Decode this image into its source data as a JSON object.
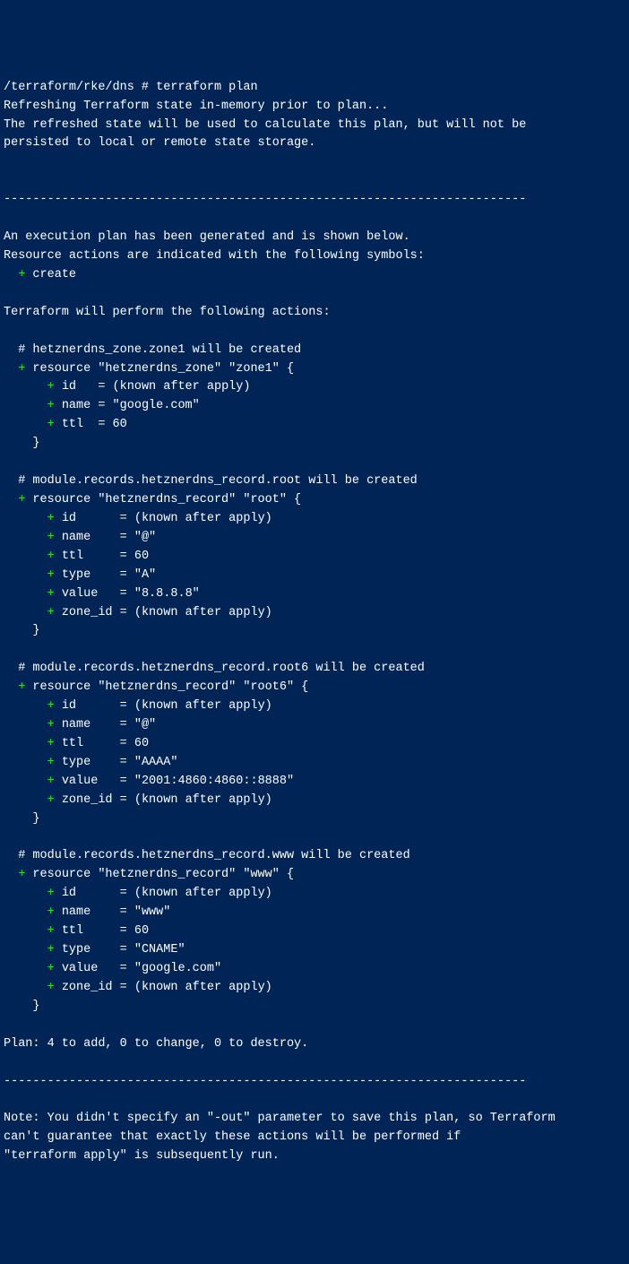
{
  "prompt": {
    "path": "/terraform/rke/dns #",
    "command": "terraform plan"
  },
  "header": {
    "l1": "Refreshing Terraform state in-memory prior to plan...",
    "l2": "The refreshed state will be used to calculate this plan, but will not be",
    "l3": "persisted to local or remote state storage.",
    "hr": "------------------------------------------------------------------------",
    "l4": "An execution plan has been generated and is shown below.",
    "l5": "Resource actions are indicated with the following symbols:",
    "create_sym": "+",
    "create_word": "create",
    "l6": "Terraform will perform the following actions:"
  },
  "resources": [
    {
      "comment": "# hetznerdns_zone.zone1 will be created",
      "decl_pre": " resource \"hetznerdns_zone\" \"zone1\" {",
      "attrs": [
        {
          "key": "id  ",
          "val": "(known after apply)"
        },
        {
          "key": "name",
          "val": "\"google.com\""
        },
        {
          "key": "ttl ",
          "val": "60"
        }
      ],
      "close": "    }"
    },
    {
      "comment": "# module.records.hetznerdns_record.root will be created",
      "decl_pre": " resource \"hetznerdns_record\" \"root\" {",
      "attrs": [
        {
          "key": "id     ",
          "val": "(known after apply)"
        },
        {
          "key": "name   ",
          "val": "\"@\""
        },
        {
          "key": "ttl    ",
          "val": "60"
        },
        {
          "key": "type   ",
          "val": "\"A\""
        },
        {
          "key": "value  ",
          "val": "\"8.8.8.8\""
        },
        {
          "key": "zone_id",
          "val": "(known after apply)"
        }
      ],
      "close": "    }"
    },
    {
      "comment": "# module.records.hetznerdns_record.root6 will be created",
      "decl_pre": " resource \"hetznerdns_record\" \"root6\" {",
      "attrs": [
        {
          "key": "id     ",
          "val": "(known after apply)"
        },
        {
          "key": "name   ",
          "val": "\"@\""
        },
        {
          "key": "ttl    ",
          "val": "60"
        },
        {
          "key": "type   ",
          "val": "\"AAAA\""
        },
        {
          "key": "value  ",
          "val": "\"2001:4860:4860::8888\""
        },
        {
          "key": "zone_id",
          "val": "(known after apply)"
        }
      ],
      "close": "    }"
    },
    {
      "comment": "# module.records.hetznerdns_record.www will be created",
      "decl_pre": " resource \"hetznerdns_record\" \"www\" {",
      "attrs": [
        {
          "key": "id     ",
          "val": "(known after apply)"
        },
        {
          "key": "name   ",
          "val": "\"www\""
        },
        {
          "key": "ttl    ",
          "val": "60"
        },
        {
          "key": "type   ",
          "val": "\"CNAME\""
        },
        {
          "key": "value  ",
          "val": "\"google.com\""
        },
        {
          "key": "zone_id",
          "val": "(known after apply)"
        }
      ],
      "close": "    }"
    }
  ],
  "footer": {
    "plan": "Plan: 4 to add, 0 to change, 0 to destroy.",
    "hr": "------------------------------------------------------------------------",
    "n1": "Note: You didn't specify an \"-out\" parameter to save this plan, so Terraform",
    "n2": "can't guarantee that exactly these actions will be performed if",
    "n3": "\"terraform apply\" is subsequently run."
  }
}
